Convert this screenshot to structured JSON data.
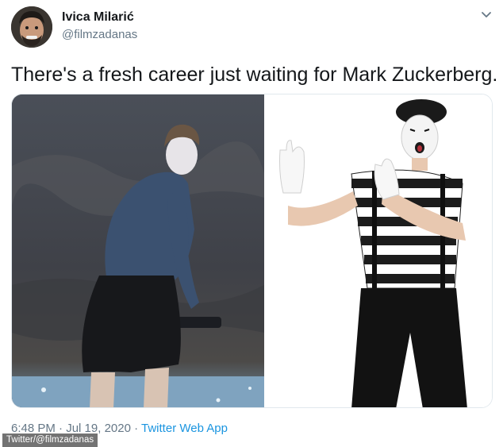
{
  "author": {
    "name": "Ivica Milarić",
    "handle": "@filmzadanas",
    "avatar_icon": "avatar-photo"
  },
  "menu": {
    "icon": "chevron-down-icon"
  },
  "tweet": {
    "text": "There's a fresh career just waiting for Mark Zuckerberg."
  },
  "media": {
    "left_image": "person-paddleboarding-photo",
    "right_image": "mime-costume-photo"
  },
  "meta": {
    "time": "6:48 PM",
    "separator1": " · ",
    "date": "Jul 19, 2020",
    "separator2": " · ",
    "source": "Twitter Web App"
  },
  "credit": {
    "text": "Twitter/@filmzadanas"
  },
  "colors": {
    "link": "#1b95e0",
    "secondary_text": "#657786",
    "primary_text": "#14171a"
  }
}
